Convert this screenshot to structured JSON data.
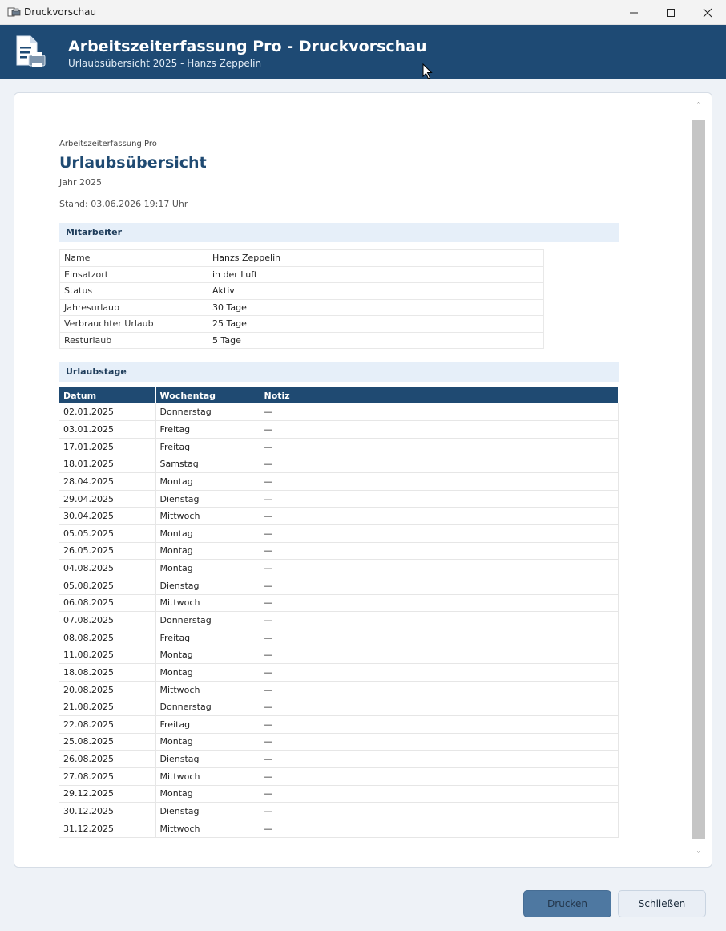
{
  "window": {
    "title": "Druckvorschau",
    "controls": {
      "minimize": "–",
      "maximize": "☐",
      "close": "✕"
    }
  },
  "header": {
    "title": "Arbeitszeiterfassung Pro - Druckvorschau",
    "subtitle": "Urlaubsübersicht 2025 - Hanzs Zeppelin"
  },
  "document": {
    "app_name": "Arbeitszeiterfassung Pro",
    "title": "Urlaubsübersicht",
    "year": "Jahr 2025",
    "stand": "Stand: 03.06.2026 19:17 Uhr",
    "employee_section": "Mitarbeiter",
    "employee": [
      {
        "label": "Name",
        "value": "Hanzs Zeppelin"
      },
      {
        "label": "Einsatzort",
        "value": "in der Luft"
      },
      {
        "label": "Status",
        "value": "Aktiv"
      },
      {
        "label": "Jahresurlaub",
        "value": "30 Tage"
      },
      {
        "label": "Verbrauchter Urlaub",
        "value": "25 Tage"
      },
      {
        "label": "Resturlaub",
        "value": "5 Tage"
      }
    ],
    "vacation_section": "Urlaubstage",
    "columns": [
      "Datum",
      "Wochentag",
      "Notiz"
    ],
    "days": [
      [
        "02.01.2025",
        "Donnerstag",
        "—"
      ],
      [
        "03.01.2025",
        "Freitag",
        "—"
      ],
      [
        "17.01.2025",
        "Freitag",
        "—"
      ],
      [
        "18.01.2025",
        "Samstag",
        "—"
      ],
      [
        "28.04.2025",
        "Montag",
        "—"
      ],
      [
        "29.04.2025",
        "Dienstag",
        "—"
      ],
      [
        "30.04.2025",
        "Mittwoch",
        "—"
      ],
      [
        "05.05.2025",
        "Montag",
        "—"
      ],
      [
        "26.05.2025",
        "Montag",
        "—"
      ],
      [
        "04.08.2025",
        "Montag",
        "—"
      ],
      [
        "05.08.2025",
        "Dienstag",
        "—"
      ],
      [
        "06.08.2025",
        "Mittwoch",
        "—"
      ],
      [
        "07.08.2025",
        "Donnerstag",
        "—"
      ],
      [
        "08.08.2025",
        "Freitag",
        "—"
      ],
      [
        "11.08.2025",
        "Montag",
        "—"
      ],
      [
        "18.08.2025",
        "Montag",
        "—"
      ],
      [
        "20.08.2025",
        "Mittwoch",
        "—"
      ],
      [
        "21.08.2025",
        "Donnerstag",
        "—"
      ],
      [
        "22.08.2025",
        "Freitag",
        "—"
      ],
      [
        "25.08.2025",
        "Montag",
        "—"
      ],
      [
        "26.08.2025",
        "Dienstag",
        "—"
      ],
      [
        "27.08.2025",
        "Mittwoch",
        "—"
      ],
      [
        "29.12.2025",
        "Montag",
        "—"
      ],
      [
        "30.12.2025",
        "Dienstag",
        "—"
      ],
      [
        "31.12.2025",
        "Mittwoch",
        "—"
      ]
    ]
  },
  "scrollbar": {
    "up": "˄",
    "down": "˅"
  },
  "buttons": {
    "print": "Drucken",
    "close": "Schließen"
  },
  "icons": {
    "app": "print-preview-icon",
    "header": "document-printer-icon",
    "cursor": "mouse-pointer-icon"
  },
  "colors": {
    "header_bg": "#1e4a74",
    "table_header_bg": "#1f4a72",
    "section_bg": "#e6eff9",
    "print_button_bg": "#4e78a1"
  }
}
